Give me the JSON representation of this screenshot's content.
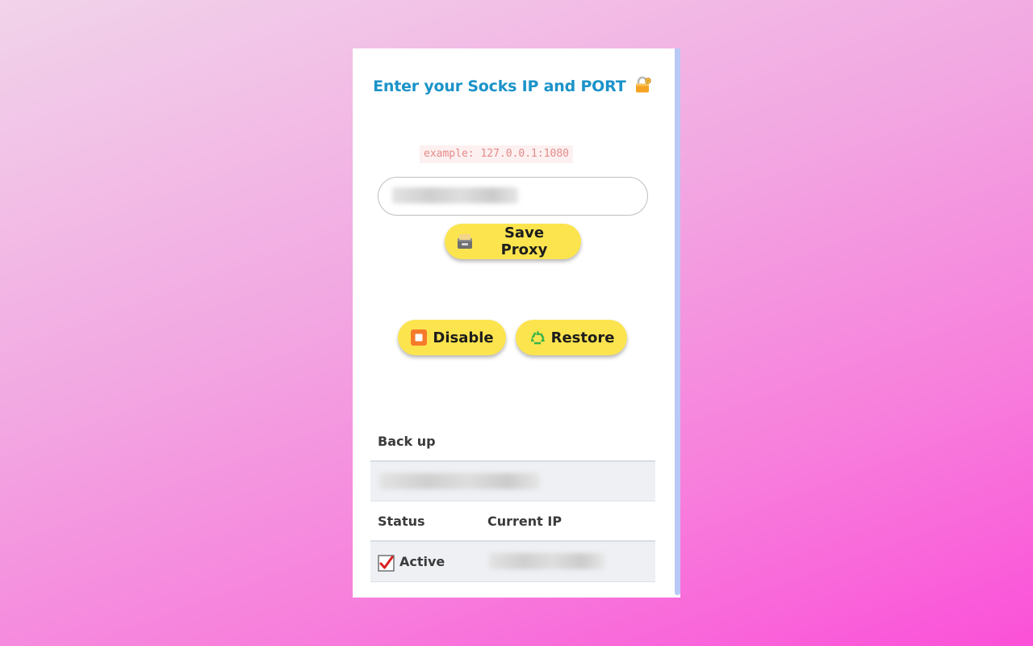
{
  "popup": {
    "title": "Enter your Socks IP and PORT",
    "example": "example: 127.0.0.1:1080",
    "proxy_input": {
      "value": "",
      "placeholder": ""
    },
    "buttons": {
      "save": "Save Proxy",
      "disable": "Disable",
      "restore": "Restore"
    },
    "backup": {
      "heading": "Back up",
      "value": ""
    },
    "status_table": {
      "headers": [
        "Status",
        "Current IP"
      ],
      "status_value": "Active",
      "current_ip": ""
    }
  },
  "icons": {
    "title": "lock-key-icon",
    "save": "card-file-box-icon",
    "disable": "stop-button-icon",
    "restore": "recycle-icon",
    "status": "check-mark-icon"
  },
  "colors": {
    "accent_title": "#1b93c9",
    "button_bg": "#fce44f",
    "example_text": "#e58a8a",
    "row_bg": "#eef0f4"
  }
}
